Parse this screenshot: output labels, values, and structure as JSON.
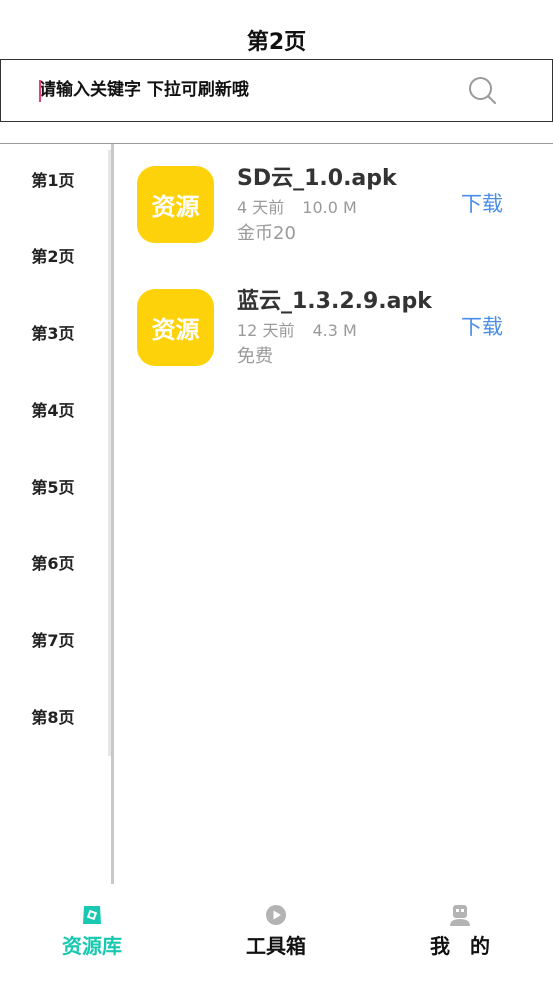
{
  "header": {
    "title": "第2页"
  },
  "search": {
    "placeholder": "请输入关键字 下拉可刷新哦",
    "icon": "search-icon"
  },
  "sidebar": {
    "items": [
      {
        "label": "第1页"
      },
      {
        "label": "第2页"
      },
      {
        "label": "第3页"
      },
      {
        "label": "第4页"
      },
      {
        "label": "第5页"
      },
      {
        "label": "第6页"
      },
      {
        "label": "第7页"
      },
      {
        "label": "第8页"
      }
    ]
  },
  "list": {
    "items": [
      {
        "badge": "资源",
        "name": "SD云_1.0.apk",
        "time": "4 天前",
        "size": "10.0 M",
        "price": "金币20",
        "action": "下载"
      },
      {
        "badge": "资源",
        "name": "蓝云_1.3.2.9.apk",
        "time": "12 天前",
        "size": "4.3 M",
        "price": "免费",
        "action": "下载"
      }
    ]
  },
  "tabs": [
    {
      "label": "资源库",
      "icon": "resource-icon",
      "active": true
    },
    {
      "label": "工具箱",
      "icon": "play-icon",
      "active": false
    },
    {
      "label": "我　的",
      "icon": "profile-icon",
      "active": false
    }
  ],
  "colors": {
    "accent": "#18c8b0",
    "badge": "#fdd20a",
    "link": "#4a8ee8",
    "caret": "#e0447a"
  }
}
